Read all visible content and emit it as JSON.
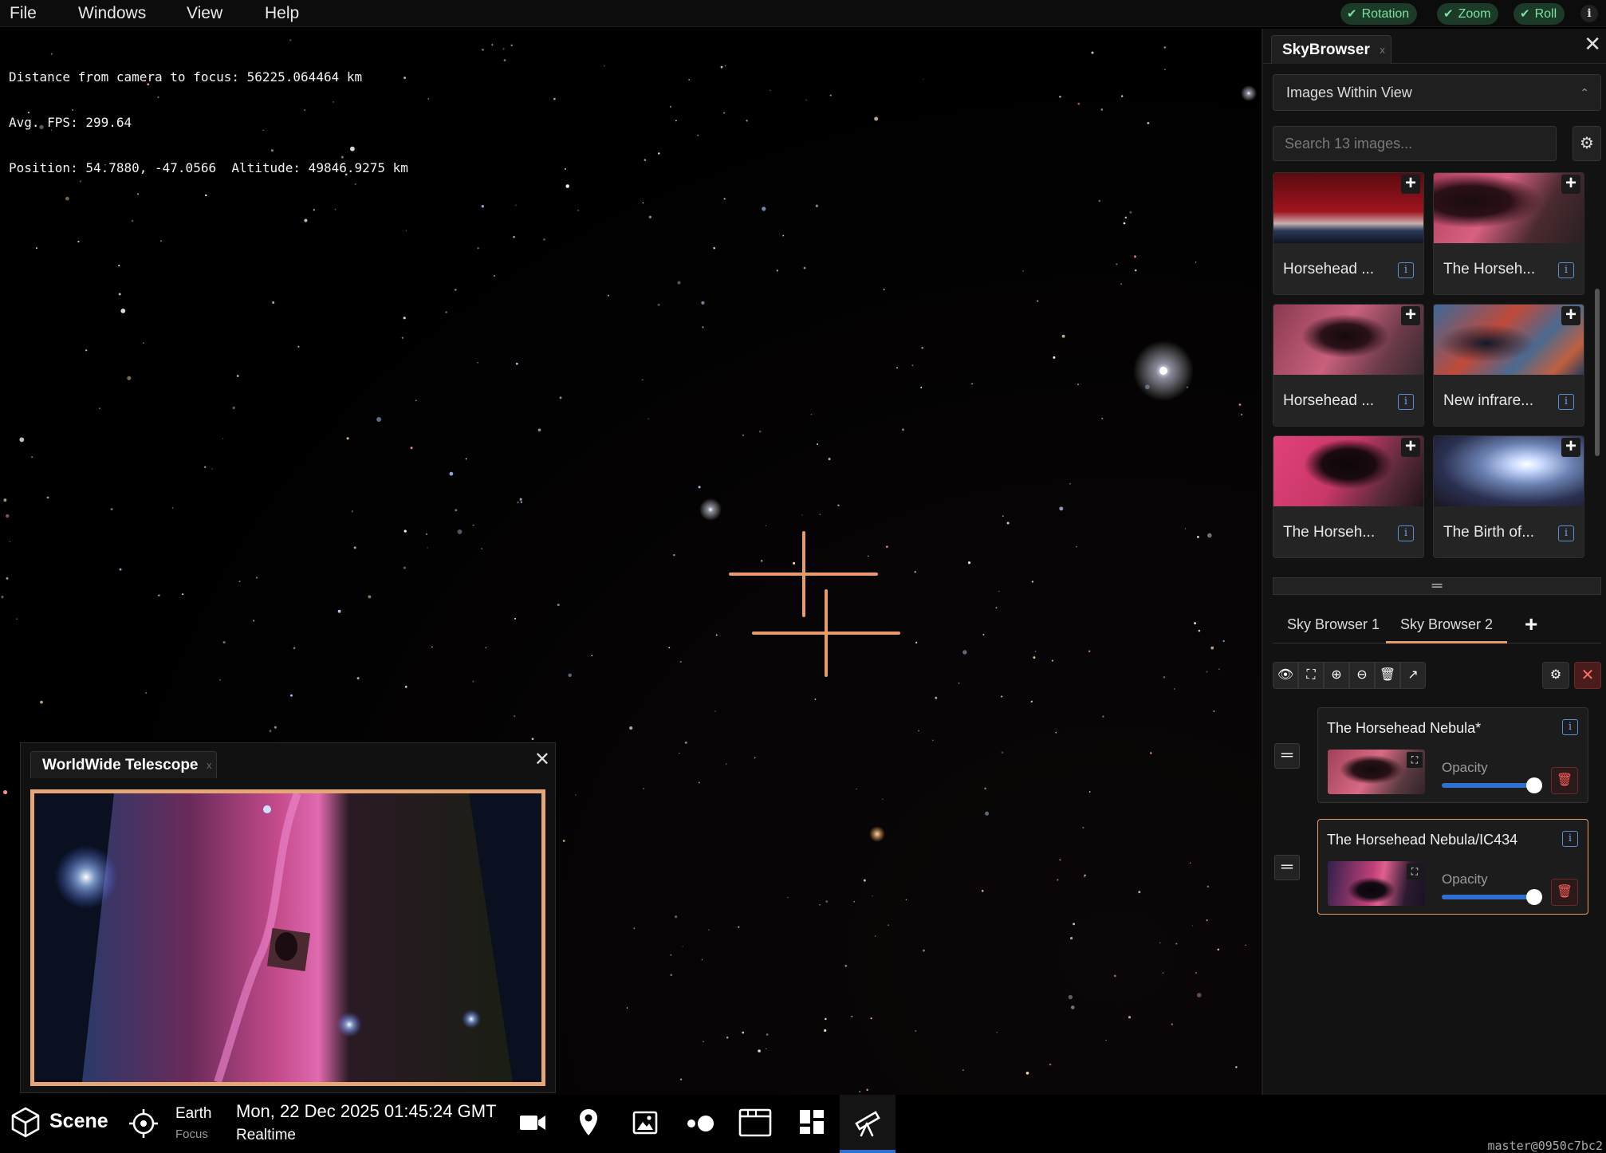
{
  "menu": {
    "items": [
      "File",
      "Windows",
      "View",
      "Help"
    ],
    "toggles": [
      "Rotation",
      "Zoom",
      "Roll"
    ],
    "info_icon": "info-icon"
  },
  "hud": {
    "line1": "Distance from camera to focus: 56225.064464 km",
    "line2": "Avg. FPS: 299.64",
    "line3": "Position: 54.7880, -47.0566  Altitude: 49846.9275 km"
  },
  "skybrowser": {
    "tab_title": "SkyBrowser",
    "tab_close": "x",
    "select_value": "Images Within View",
    "search_placeholder": "Search 13 images...",
    "images": [
      {
        "title": "Horsehead ...",
        "theme": "red-horizon"
      },
      {
        "title": "The Horseh...",
        "theme": "pink-dark"
      },
      {
        "title": "Horsehead ...",
        "theme": "pink-purple"
      },
      {
        "title": "New infrare...",
        "theme": "blue-red"
      },
      {
        "title": "The Horseh...",
        "theme": "magenta-dark"
      },
      {
        "title": "The Birth of...",
        "theme": "blue-white"
      }
    ],
    "browser_tabs": [
      "Sky Browser 1",
      "Sky Browser 2"
    ],
    "active_tab": "Sky Browser 2",
    "layers": [
      {
        "title": "The Horsehead Nebula*",
        "opacity_label": "Opacity",
        "opacity": 1.0,
        "selected": false
      },
      {
        "title": "The Horsehead Nebula/IC434",
        "opacity_label": "Opacity",
        "opacity": 1.0,
        "selected": true
      }
    ]
  },
  "wwt": {
    "tab_title": "WorldWide Telescope",
    "tab_close": "x"
  },
  "bottombar": {
    "scene_label": "Scene",
    "focus_name": "Earth",
    "focus_label": "Focus",
    "datetime": "Mon, 22 Dec 2025 01:45:24 GMT",
    "time_mode": "Realtime",
    "version": "master@0950c7bc2"
  },
  "colors": {
    "accent": "#e89a68",
    "toggle_bg": "#1b3a27",
    "toggle_text": "#7fe0a0",
    "info_blue": "#6aa2ee",
    "danger": "#ff5c5c"
  }
}
